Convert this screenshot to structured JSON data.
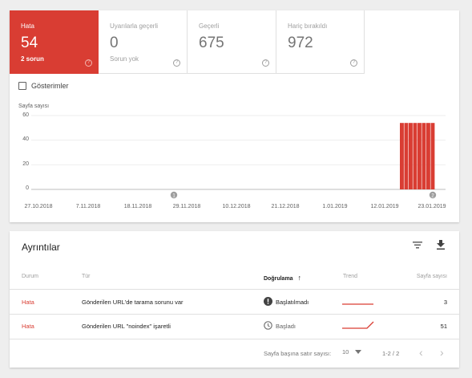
{
  "tiles": [
    {
      "title": "Hata",
      "value": "54",
      "sub": "2 sorun",
      "help": "?"
    },
    {
      "title": "Uyarılarla geçerli",
      "value": "0",
      "sub": "Sorun yok",
      "help": "?"
    },
    {
      "title": "Geçerli",
      "value": "675",
      "sub": "",
      "help": "?"
    },
    {
      "title": "Hariç bırakıldı",
      "value": "972",
      "sub": "",
      "help": "?"
    }
  ],
  "impressions_label": "Gösterimler",
  "chart_data": {
    "type": "bar",
    "ylabel": "Sayfa sayısı",
    "ylim": [
      0,
      60
    ],
    "yticks": [
      "60",
      "40",
      "20",
      "0"
    ],
    "xticks": [
      "27.10.2018",
      "7.11.2018",
      "18.11.2018",
      "29.11.2018",
      "10.12.2018",
      "21.12.2018",
      "1.01.2019",
      "12.01.2019",
      "23.01.2019"
    ],
    "bar_color": "#d93d33",
    "series": [
      {
        "values": [
          54,
          54,
          54,
          54,
          54,
          54,
          54,
          54
        ]
      }
    ],
    "annotations": [
      "1",
      "2"
    ]
  },
  "details": {
    "title": "Ayrıntılar",
    "filter_icon": "filter-icon",
    "download_icon": "download-icon",
    "columns": {
      "status": "Durum",
      "type": "Tür",
      "validation": "Doğrulama",
      "trend": "Trend",
      "pages": "Sayfa sayısı"
    },
    "sort_arrow": "↑",
    "rows": [
      {
        "status": "Hata",
        "type": "Gönderilen URL'de tarama sorunu var",
        "validation": "Başlatılmadı",
        "validation_icon": "error-icon",
        "pages": "3"
      },
      {
        "status": "Hata",
        "type": "Gönderilen URL \"noindex\" işaretli",
        "validation": "Başladı",
        "validation_icon": "clock-icon",
        "pages": "51"
      }
    ],
    "footer": {
      "rows_per_page_label": "Sayfa başına satır sayısı:",
      "rows_per_page": "10",
      "range": "1-2 / 2",
      "prev": "‹",
      "next": "›"
    }
  }
}
